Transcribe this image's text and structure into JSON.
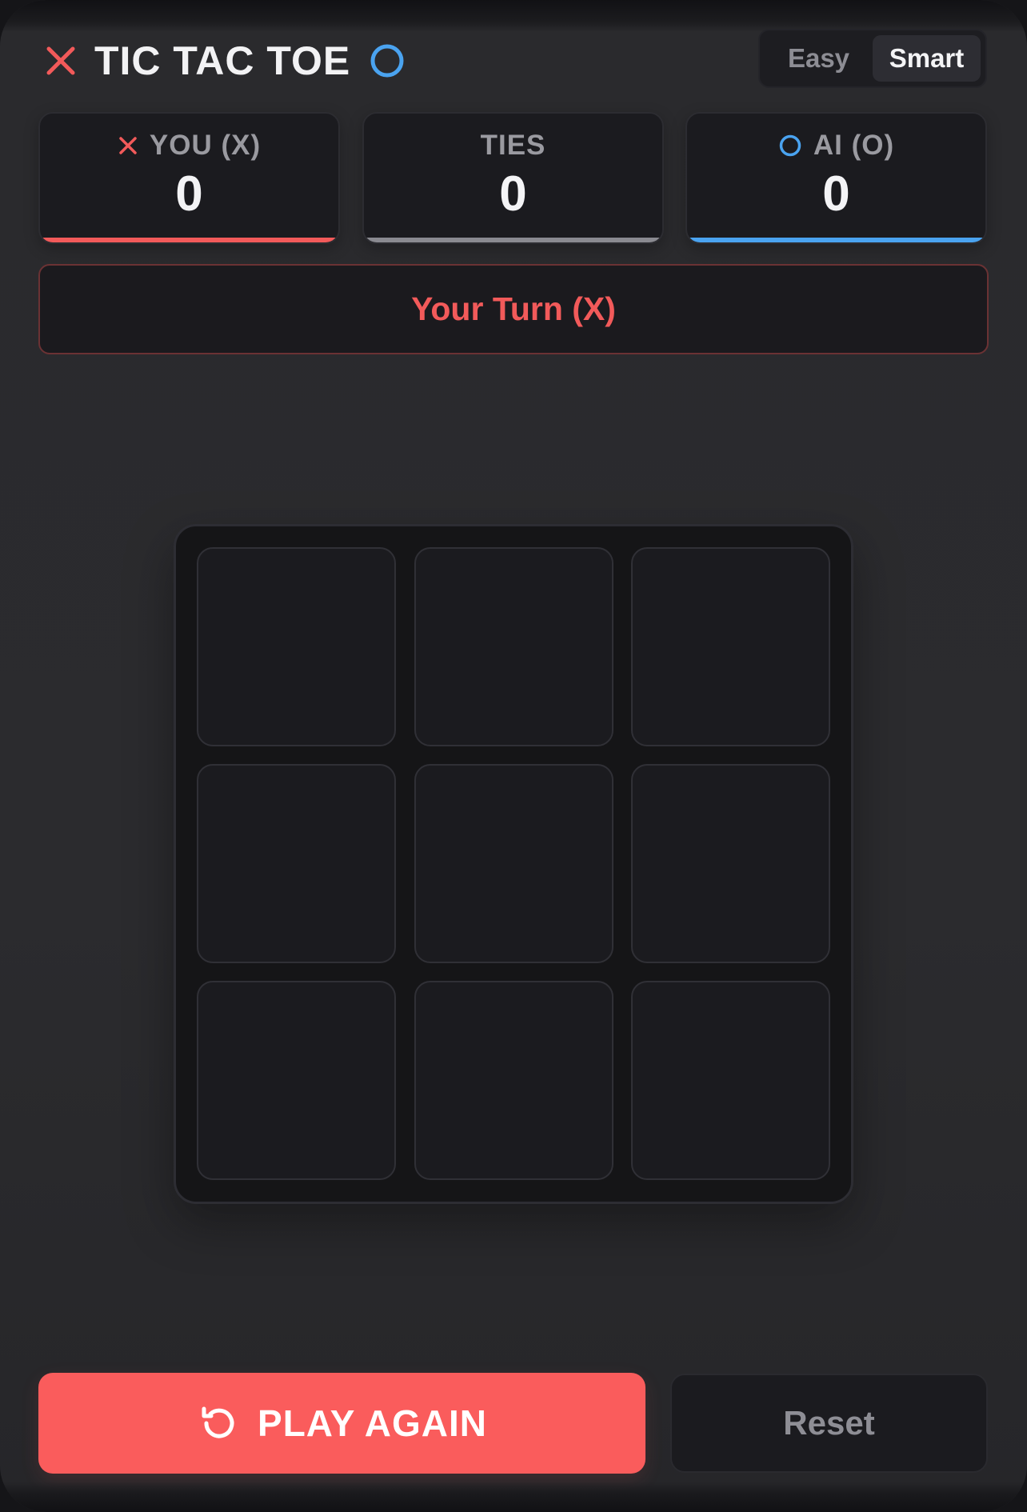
{
  "header": {
    "title": "TIC TAC TOE",
    "modes": [
      {
        "label": "Easy",
        "active": false
      },
      {
        "label": "Smart",
        "active": true
      }
    ]
  },
  "scores": {
    "you": {
      "label": "YOU (X)",
      "value": "0",
      "icon": "x-icon",
      "color": "#f25a5a"
    },
    "ties": {
      "label": "TIES",
      "value": "0",
      "color": "#8a8a90"
    },
    "ai": {
      "label": "AI (O)",
      "value": "0",
      "icon": "o-icon",
      "color": "#4aa3f0"
    }
  },
  "status": {
    "text": "Your Turn (X)",
    "color": "#f25a5a"
  },
  "board": {
    "cells": [
      "",
      "",
      "",
      "",
      "",
      "",
      "",
      "",
      ""
    ]
  },
  "actions": {
    "play_again_label": "PLAY AGAIN",
    "reset_label": "Reset"
  },
  "colors": {
    "x": "#f25a5a",
    "o": "#4aa3f0",
    "accent": "#fa5c5c"
  }
}
